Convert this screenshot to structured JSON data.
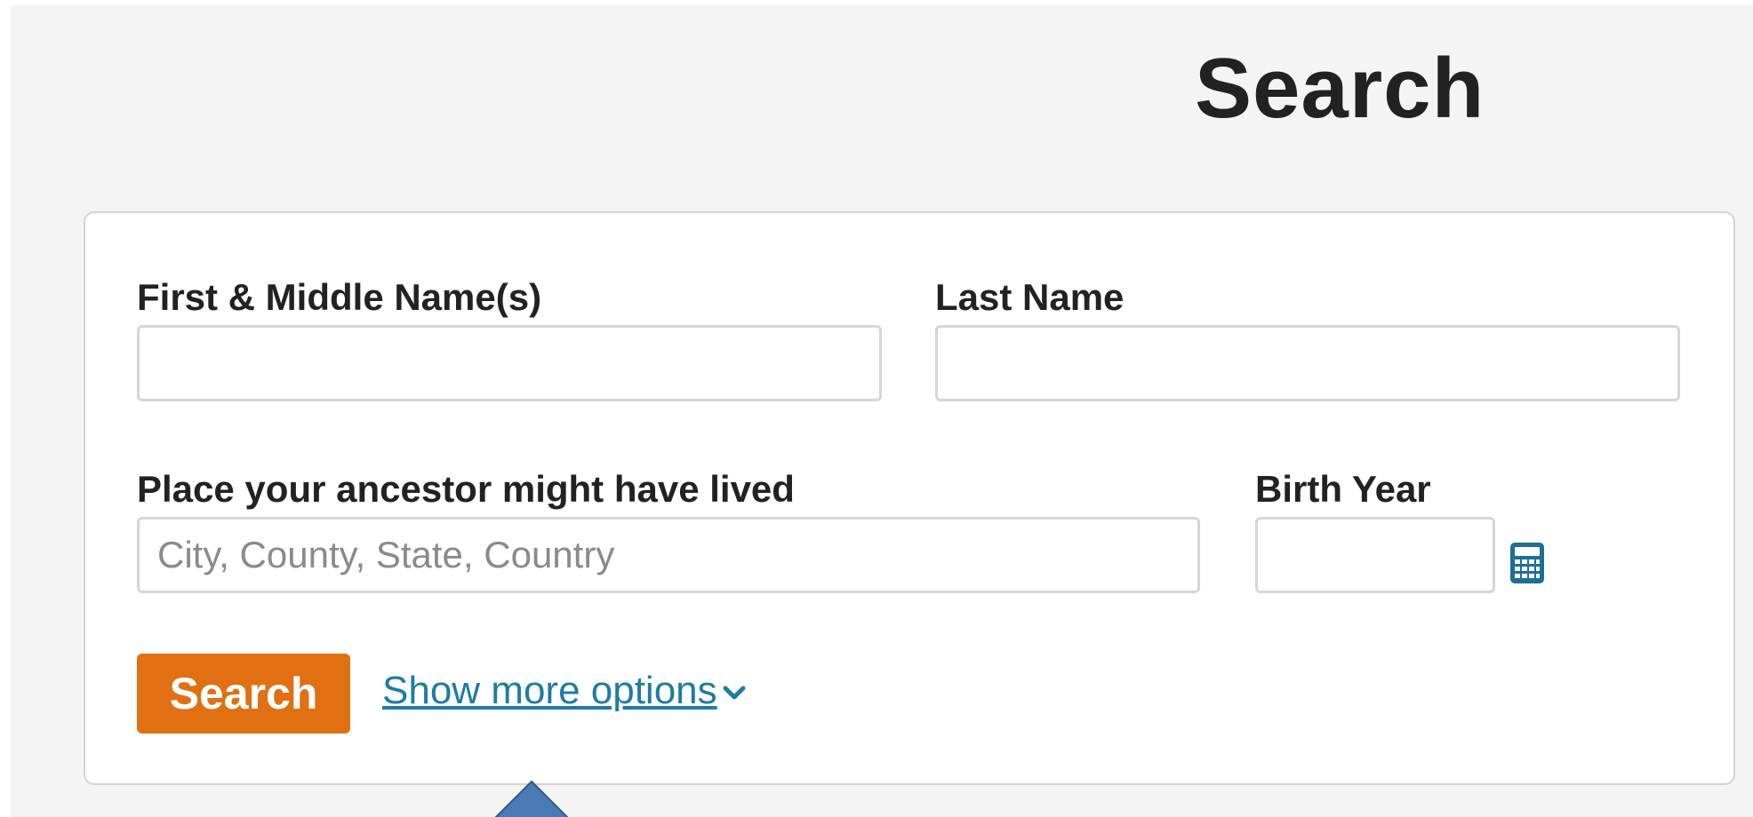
{
  "page": {
    "title": "Search"
  },
  "form": {
    "first_name": {
      "label": "First & Middle Name(s)",
      "value": "",
      "placeholder": ""
    },
    "last_name": {
      "label": "Last Name",
      "value": "",
      "placeholder": ""
    },
    "place": {
      "label": "Place your ancestor might have lived",
      "value": "",
      "placeholder": "City, County, State, Country"
    },
    "birth_year": {
      "label": "Birth Year",
      "value": "",
      "placeholder": "",
      "icon": "calculator-icon"
    },
    "search_button_label": "Search",
    "more_options_label": "Show more options",
    "more_options_icon": "chevron-down-icon"
  },
  "colors": {
    "accent": "#e07012",
    "link": "#1d7ca3",
    "page_background": "#f4f4f4",
    "arrow": "#3f6ea3"
  }
}
